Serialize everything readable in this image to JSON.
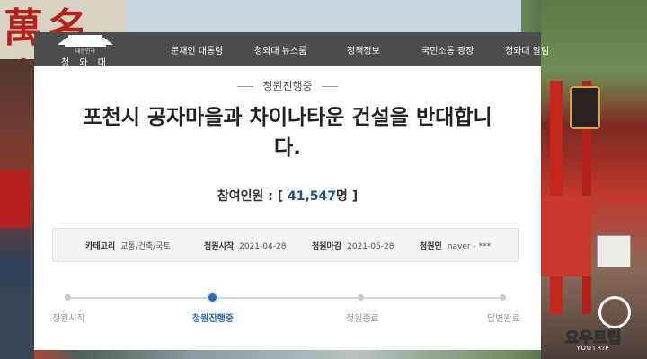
{
  "background": {
    "sign_text": "萬名山",
    "watermark": {
      "text": "요우트립",
      "sub": "YOUTRIP"
    }
  },
  "site": {
    "logo_sub": "대한민국",
    "logo_name": "청 와 대"
  },
  "nav": {
    "items": [
      "문재인 대통령",
      "청와대 뉴스룸",
      "정책정보",
      "국민소통 광장",
      "청와대 알림"
    ]
  },
  "petition": {
    "status": "청원진행중",
    "title": "포천시 공자마을과 차이나타운 건설을 반대합니다.",
    "participants_label": "참여인원 : [ ",
    "participants_count": "41,547",
    "participants_suffix": "명 ]",
    "info": [
      {
        "label": "카테고리",
        "value": "교통/건축/국토"
      },
      {
        "label": "청원시작",
        "value": "2021-04-28"
      },
      {
        "label": "청원마감",
        "value": "2021-05-28"
      },
      {
        "label": "청원인",
        "value": "naver - ***"
      }
    ],
    "steps": [
      "청원시작",
      "청원진행중",
      "청원종료",
      "답변완료"
    ],
    "active_step": 1
  },
  "colors": {
    "nav_bg": "#4d4d4d",
    "accent": "#2d6cb5",
    "count": "#1f4e79"
  }
}
